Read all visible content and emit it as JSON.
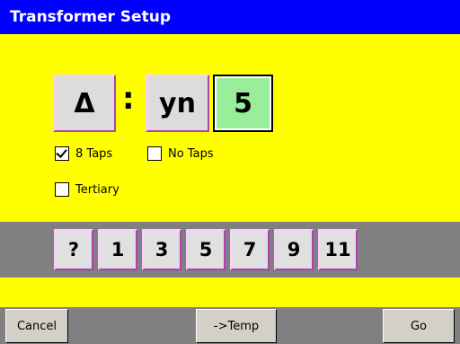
{
  "window": {
    "title": "Transformer Setup"
  },
  "vector_group": {
    "primary": "Δ",
    "separator": ":",
    "secondary": "yn",
    "phase_shift": "5"
  },
  "options": {
    "taps8": {
      "label": "8 Taps",
      "checked": true
    },
    "no_taps": {
      "label": "No Taps",
      "checked": false
    },
    "tertiary": {
      "label": "Tertiary",
      "checked": false
    }
  },
  "phase_buttons": [
    "?",
    "1",
    "3",
    "5",
    "7",
    "9",
    "11"
  ],
  "footer": {
    "cancel": "Cancel",
    "temp": "->Temp",
    "go": "Go"
  },
  "colors": {
    "background": "#ffff00",
    "titlebar": "#0000ff",
    "selected_button": "#99ee99",
    "strip": "#808080"
  }
}
